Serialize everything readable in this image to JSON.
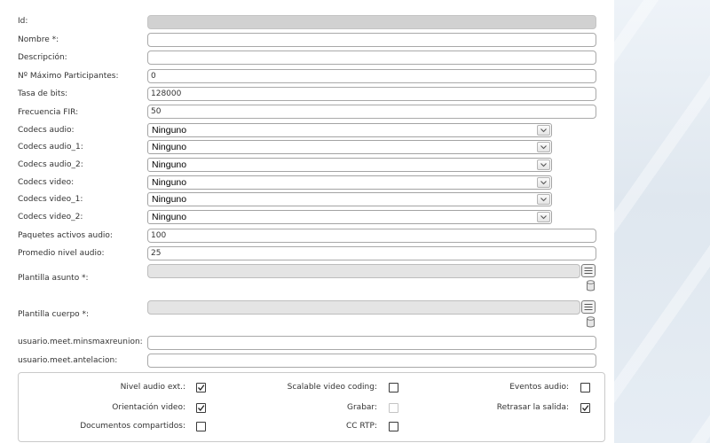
{
  "form": {
    "id": {
      "label": "Id:"
    },
    "nombre": {
      "label": "Nombre *:"
    },
    "descripcion": {
      "label": "Descripción:"
    },
    "max_participantes": {
      "label": "Nº Máximo Participantes:",
      "value": "0"
    },
    "tasa_bits": {
      "label": "Tasa de bits:",
      "value": "128000"
    },
    "frecuencia_fir": {
      "label": "Frecuencia FIR:",
      "value": "50"
    },
    "codecs_audio": {
      "label": "Codecs audio:",
      "selected": "Ninguno"
    },
    "codecs_audio_1": {
      "label": "Codecs audio_1:",
      "selected": "Ninguno"
    },
    "codecs_audio_2": {
      "label": "Codecs audio_2:",
      "selected": "Ninguno"
    },
    "codecs_video": {
      "label": "Codecs video:",
      "selected": "Ninguno"
    },
    "codecs_video_1": {
      "label": "Codecs video_1:",
      "selected": "Ninguno"
    },
    "codecs_video_2": {
      "label": "Codecs video_2:",
      "selected": "Ninguno"
    },
    "paquetes_activos_audio": {
      "label": "Paquetes activos audio:",
      "value": "100"
    },
    "promedio_nivel_audio": {
      "label": "Promedio nivel audio:",
      "value": "25"
    },
    "plantilla_asunto": {
      "label": "Plantilla asunto *:"
    },
    "plantilla_cuerpo": {
      "label": "Plantilla cuerpo *:"
    },
    "minsmaxreunion": {
      "label": "usuario.meet.minsmaxreunion:"
    },
    "antelacion": {
      "label": "usuario.meet.antelacion:"
    }
  },
  "options": {
    "nivel_audio_ext": {
      "label": "Nivel audio ext.:",
      "checked": true
    },
    "scalable_video_coding": {
      "label": "Scalable video coding:",
      "checked": false
    },
    "eventos_audio": {
      "label": "Eventos audio:",
      "checked": false
    },
    "orientacion_video": {
      "label": "Orientación video:",
      "checked": true
    },
    "grabar": {
      "label": "Grabar:",
      "checked": false,
      "disabled": true
    },
    "retrasar_salida": {
      "label": "Retrasar la salida:",
      "checked": true
    },
    "documentos_compartidos": {
      "label": "Documentos compartidos:",
      "checked": false
    },
    "cc_rtp": {
      "label": "CC RTP:",
      "checked": false
    }
  },
  "icons": {
    "select_arrow": "chevron-down-icon",
    "template_picker": "list-icon",
    "template_clear": "trash-icon",
    "checkbox_mark": "check-icon"
  },
  "colors": {
    "panel_background": "#ffffff",
    "page_background": "#e6edf4",
    "label_text": "#333333",
    "disabled_field": "#d1d1d1",
    "readonly_field": "#e4e4e4"
  }
}
